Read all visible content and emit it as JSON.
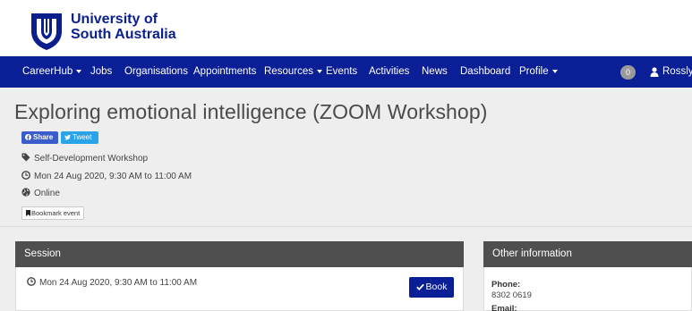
{
  "brand": {
    "line1": "University of",
    "line2": "South Australia",
    "color": "#0b1f8c"
  },
  "nav": {
    "items": [
      {
        "label": "CareerHub",
        "dropdown": true
      },
      {
        "label": "Jobs"
      },
      {
        "label": "Organisations"
      },
      {
        "label": "Appointments"
      },
      {
        "label": "Resources",
        "dropdown": true
      },
      {
        "label": "Events"
      },
      {
        "label": "Activities"
      },
      {
        "label": "News"
      },
      {
        "label": "Dashboard"
      },
      {
        "label": "Profile",
        "dropdown": true
      }
    ],
    "notification_count": "0",
    "user_name": "Rosslyn",
    "background": "#0a1e96"
  },
  "event": {
    "title": "Exploring emotional intelligence (ZOOM Workshop)",
    "share_label": "Share",
    "tweet_label": "Tweet",
    "category": "Self-Development Workshop",
    "datetime": "Mon 24 Aug 2020, 9:30 AM to 11:00 AM",
    "location": "Online",
    "bookmark_label": "Bookmark event"
  },
  "session": {
    "heading": "Session",
    "time": "Mon 24 Aug 2020, 9:30 AM to 11:00 AM",
    "book_label": "Book"
  },
  "other_info": {
    "heading": "Other information",
    "phone_label": "Phone:",
    "phone_value": "8302 0619",
    "email_label": "Email:"
  }
}
